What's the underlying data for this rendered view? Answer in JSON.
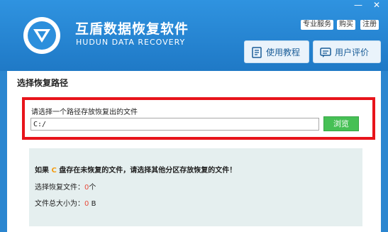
{
  "app": {
    "title": "互盾数据恢复软件",
    "subtitle": "HUDUN DATA RECOVERY"
  },
  "window_controls": {
    "minimize": "—",
    "close": "✕"
  },
  "top_links": [
    "专业服务",
    "购买",
    "注册"
  ],
  "header_buttons": [
    {
      "label": "使用教程",
      "icon": "book-icon"
    },
    {
      "label": "用户评价",
      "icon": "comment-icon"
    }
  ],
  "section": {
    "title": "选择恢复路径"
  },
  "path_select": {
    "label": "请选择一个路径存放恢复出的文件",
    "value": "C:/",
    "browse_label": "浏览"
  },
  "info": {
    "warn_prefix": "如果",
    "warn_drive": "C",
    "warn_suffix": "盘存在未恢复的文件，请选择其他分区存放恢复的文件！",
    "selected_label": "选择恢复文件：",
    "selected_count": "0",
    "selected_unit": "个",
    "size_label": "文件总大小为：",
    "size_value": "0",
    "size_unit": "B"
  },
  "colors": {
    "header": "#2b86d0",
    "highlight_box": "#e8141b",
    "browse_button": "#46c055",
    "info_panel": "#e5efef"
  }
}
